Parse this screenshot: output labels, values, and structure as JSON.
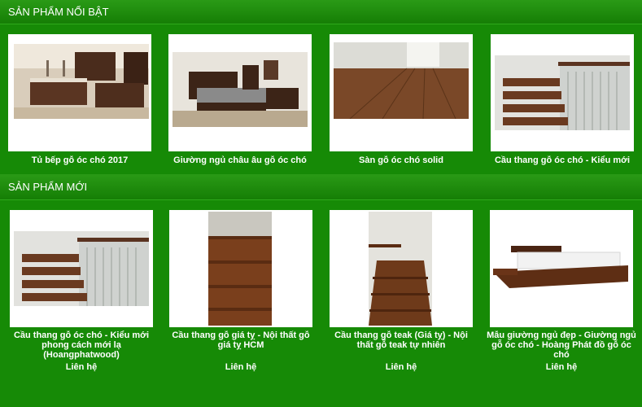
{
  "sections": {
    "featured": {
      "title": "SẢN PHẨM NỔI BẬT",
      "products": [
        {
          "name": "Tủ bếp gỗ óc chó 2017",
          "image": "kitchen-cabinet-photo"
        },
        {
          "name": "Giường ngủ châu âu gỗ óc chó",
          "image": "bedroom-photo"
        },
        {
          "name": "Sàn gỗ óc chó solid",
          "image": "wood-floor-photo"
        },
        {
          "name": "Cầu thang gỗ óc chó - Kiểu mới",
          "image": "staircase-photo"
        }
      ]
    },
    "new": {
      "title": "SẢN PHẨM MỚI",
      "products": [
        {
          "name": "Cầu thang gỗ óc chó - Kiểu mới phong cách mới lạ (Hoangphatwood)",
          "price": "Liên hệ",
          "image": "staircase-photo"
        },
        {
          "name": "Cầu thang gỗ giá tỵ - Nội thất gỗ giá tỵ HCM",
          "price": "Liên hệ",
          "image": "staircase-photo"
        },
        {
          "name": "Cầu thang gỗ teak (Giá tỵ) - Nội thất gỗ teak tự nhiên",
          "price": "Liên hệ",
          "image": "staircase-photo"
        },
        {
          "name": "Mẫu giường ngủ đẹp - Giường ngủ gỗ óc chó - Hoàng Phát đồ gỗ óc chó",
          "price": "Liên hệ",
          "image": "bed-photo"
        }
      ]
    }
  }
}
